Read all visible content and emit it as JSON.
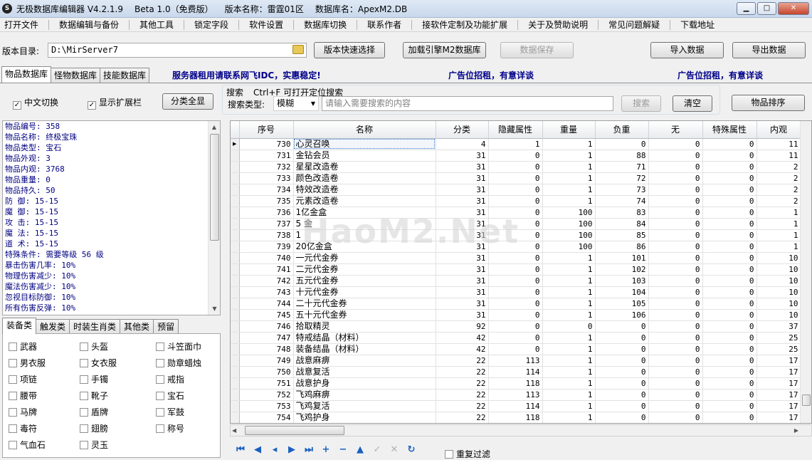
{
  "window": {
    "title": "无极数据库编辑器 V4.2.1.9",
    "edition": "Beta 1.0（免费版）",
    "version_name": "版本名称：雷霆01区",
    "db_name": "数据库名：ApexM2.DB",
    "minimize": "▁",
    "maximize": "□",
    "close": "✕"
  },
  "menu": [
    "打开文件",
    "数据编辑与备份",
    "其他工具",
    "锁定字段",
    "软件设置",
    "数据库切换",
    "联系作者",
    "接软件定制及功能扩展",
    "关于及赞助说明",
    "常见问题解疑",
    "下载地址"
  ],
  "toolbar": {
    "dir_label": "版本目录:",
    "dir_value": "D:\\MirServer7",
    "quick_select": "版本快速选择",
    "load_engine": "加载引擎M2数据库",
    "save_data": "数据保存",
    "import_data": "导入数据",
    "export_data": "导出数据"
  },
  "db_tabs": [
    "物品数据库",
    "怪物数据库",
    "技能数据库"
  ],
  "ads": {
    "server": "服务器租用请联系网飞IDC，实惠稳定!",
    "ad1": "广告位招租，有意详谈",
    "ad2": "广告位招租，有意详谈"
  },
  "options": {
    "chinese_switch": "中文切换",
    "show_ext": "显示扩展栏",
    "show_all": "分类全显"
  },
  "search": {
    "title": "搜索",
    "hint": "Ctrl+F 可打开定位搜索",
    "type_label": "搜索类型:",
    "type_value": "模糊",
    "placeholder": "请输入需要搜索的内容",
    "search_btn": "搜索",
    "clear_btn": "清空",
    "sort_btn": "物品排序"
  },
  "item_info": [
    "物品编号: 358",
    "物品名称: 终极宝珠",
    "物品类型: 宝石",
    "物品外观: 3",
    "物品内观: 3768",
    "物品重量: 0",
    "物品持久: 50",
    "防    御: 15-15",
    "魔    御: 15-15",
    "攻    击: 15-15",
    "魔    法: 15-15",
    "道    术: 15-15",
    "特殊条件: 需要等级 56 级",
    "暴击伤害几率: 10%",
    "物理伤害减少: 10%",
    "魔法伤害减少: 10%",
    "忽视目标防御: 10%",
    "所有伤害反弹: 10%"
  ],
  "cat_tabs": [
    "装备类",
    "触发类",
    "时装生肖类",
    "其他类",
    "预留"
  ],
  "categories": [
    [
      "武器",
      "头盔",
      "斗笠面巾"
    ],
    [
      "男衣服",
      "女衣服",
      "勋章蜡烛"
    ],
    [
      "项链",
      "手镯",
      "戒指"
    ],
    [
      "腰带",
      "靴子",
      "宝石"
    ],
    [
      "马牌",
      "盾牌",
      "军鼓"
    ],
    [
      "毒符",
      "翅膀",
      "称号"
    ],
    [
      "气血石",
      "灵玉"
    ]
  ],
  "grid": {
    "columns": [
      "序号",
      "名称",
      "分类",
      "隐藏属性",
      "重量",
      "负重",
      "无",
      "特殊属性",
      "内观"
    ],
    "rows": [
      [
        "730",
        "心灵召唤",
        "4",
        "1",
        "1",
        "0",
        "0",
        "0",
        "11"
      ],
      [
        "731",
        "金钻会员",
        "31",
        "0",
        "1",
        "88",
        "0",
        "0",
        "11"
      ],
      [
        "732",
        "星星改造卷",
        "31",
        "0",
        "1",
        "71",
        "0",
        "0",
        "2"
      ],
      [
        "733",
        "颜色改造卷",
        "31",
        "0",
        "1",
        "72",
        "0",
        "0",
        "2"
      ],
      [
        "734",
        "特效改造卷",
        "31",
        "0",
        "1",
        "73",
        "0",
        "0",
        "2"
      ],
      [
        "735",
        "元素改造卷",
        "31",
        "0",
        "1",
        "74",
        "0",
        "0",
        "2"
      ],
      [
        "736",
        "1亿金盒",
        "31",
        "0",
        "100",
        "83",
        "0",
        "0",
        "1"
      ],
      [
        "737",
        "5 金",
        "31",
        "0",
        "100",
        "84",
        "0",
        "0",
        "1"
      ],
      [
        "738",
        "1 ",
        "31",
        "0",
        "100",
        "85",
        "0",
        "0",
        "1"
      ],
      [
        "739",
        "20亿金盒",
        "31",
        "0",
        "100",
        "86",
        "0",
        "0",
        "1"
      ],
      [
        "740",
        "一元代金券",
        "31",
        "0",
        "1",
        "101",
        "0",
        "0",
        "10"
      ],
      [
        "741",
        "二元代金券",
        "31",
        "0",
        "1",
        "102",
        "0",
        "0",
        "10"
      ],
      [
        "742",
        "五元代金券",
        "31",
        "0",
        "1",
        "103",
        "0",
        "0",
        "10"
      ],
      [
        "743",
        "十元代金券",
        "31",
        "0",
        "1",
        "104",
        "0",
        "0",
        "10"
      ],
      [
        "744",
        "二十元代金券",
        "31",
        "0",
        "1",
        "105",
        "0",
        "0",
        "10"
      ],
      [
        "745",
        "五十元代金券",
        "31",
        "0",
        "1",
        "106",
        "0",
        "0",
        "10"
      ],
      [
        "746",
        "拾取精灵",
        "92",
        "0",
        "0",
        "0",
        "0",
        "0",
        "37"
      ],
      [
        "747",
        "特戒结晶（材料）",
        "42",
        "0",
        "1",
        "0",
        "0",
        "0",
        "25"
      ],
      [
        "748",
        "装备结晶（材料）",
        "42",
        "0",
        "1",
        "0",
        "0",
        "0",
        "25"
      ],
      [
        "749",
        "战意麻痹",
        "22",
        "113",
        "1",
        "0",
        "0",
        "0",
        "17"
      ],
      [
        "750",
        "战意复活",
        "22",
        "114",
        "1",
        "0",
        "0",
        "0",
        "17"
      ],
      [
        "751",
        "战意护身",
        "22",
        "118",
        "1",
        "0",
        "0",
        "0",
        "17"
      ],
      [
        "752",
        "飞鸡麻痹",
        "22",
        "113",
        "1",
        "0",
        "0",
        "0",
        "17"
      ],
      [
        "753",
        "飞鸡复活",
        "22",
        "114",
        "1",
        "0",
        "0",
        "0",
        "17"
      ],
      [
        "754",
        "飞鸡护身",
        "22",
        "118",
        "1",
        "0",
        "0",
        "0",
        "17"
      ]
    ]
  },
  "bottom": {
    "dup_filter": "重复过滤"
  },
  "watermark": "HaoM2.Net",
  "icons": {
    "folder": "folder-icon",
    "nav": [
      "first-record-icon",
      "prev-page-icon",
      "prev-record-icon",
      "next-record-icon",
      "last-record-icon",
      "add-record-icon",
      "delete-record-icon",
      "move-up-icon",
      "confirm-icon",
      "cancel-icon",
      "refresh-icon"
    ]
  }
}
